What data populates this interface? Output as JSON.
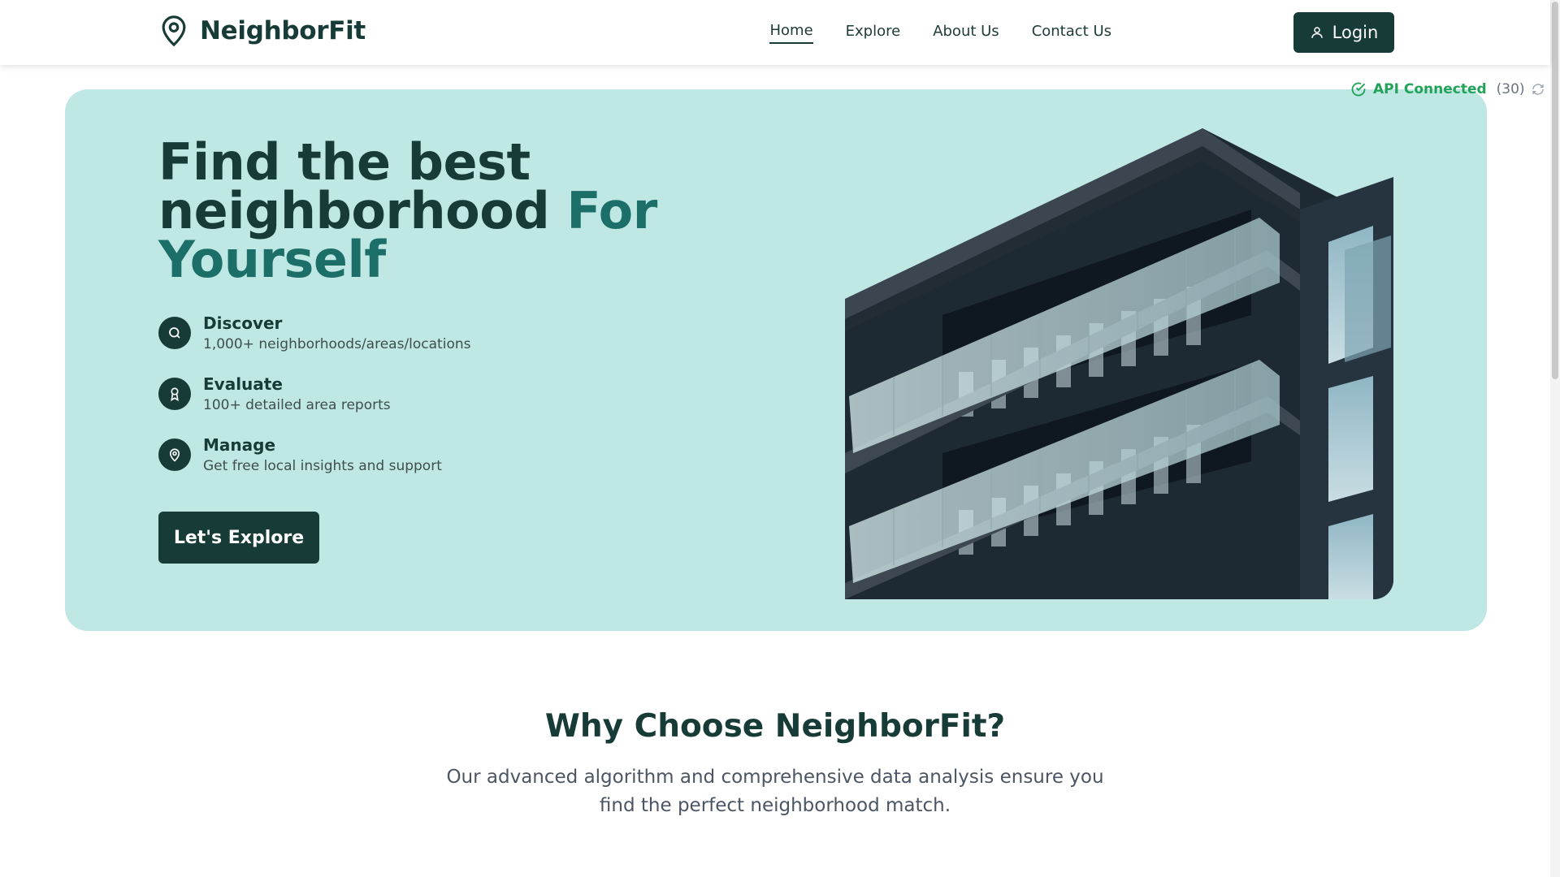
{
  "header": {
    "brand": "NeighborFit",
    "nav": [
      "Home",
      "Explore",
      "About Us",
      "Contact Us"
    ],
    "login_label": "Login"
  },
  "api": {
    "status": "API Connected",
    "count": "(30)"
  },
  "hero": {
    "title_line1": "Find the best",
    "title_line2": "neighborhood ",
    "title_accent1": "For",
    "title_accent2": "Yourself",
    "features": [
      {
        "title": "Discover",
        "desc": "1,000+ neighborhoods/areas/locations",
        "icon": "search-icon"
      },
      {
        "title": "Evaluate",
        "desc": "100+ detailed area reports",
        "icon": "award-icon"
      },
      {
        "title": "Manage",
        "desc": "Get free local insights and support",
        "icon": "map-pin-icon"
      }
    ],
    "cta": "Let's Explore"
  },
  "why": {
    "title": "Why Choose NeighborFit?",
    "desc": "Our advanced algorithm and comprehensive data analysis ensure you find the perfect neighborhood match."
  },
  "colors": {
    "primary": "#173b36",
    "accent": "#1c6f68",
    "hero_bg": "#bfe7e4",
    "status_ok": "#22a35a"
  }
}
